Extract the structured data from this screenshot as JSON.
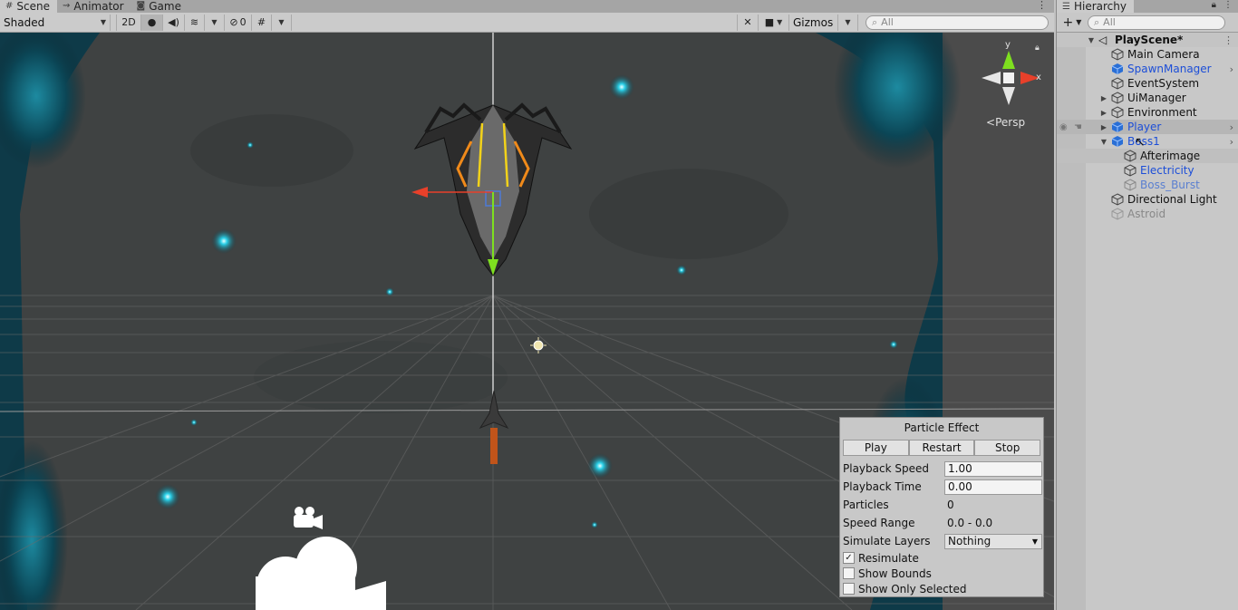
{
  "scene_tabs": [
    {
      "label": "Scene",
      "icon": "hash-icon"
    },
    {
      "label": "Animator",
      "icon": "animator-icon"
    },
    {
      "label": "Game",
      "icon": "gamepad-icon"
    }
  ],
  "toolbar": {
    "shading_mode": "Shaded",
    "mode_2d": "2D",
    "hidden_count": "0",
    "gizmos": "Gizmos",
    "search_placeholder": "All"
  },
  "viewport": {
    "projection": "Persp",
    "axis_y": "y",
    "axis_x": "x"
  },
  "particle_effect": {
    "title": "Particle Effect",
    "buttons": [
      "Play",
      "Restart",
      "Stop"
    ],
    "fields": {
      "playback_speed_label": "Playback Speed",
      "playback_speed": "1.00",
      "playback_time_label": "Playback Time",
      "playback_time": "0.00",
      "particles_label": "Particles",
      "particles": "0",
      "speed_range_label": "Speed Range",
      "speed_range": "0.0 - 0.0",
      "simulate_layers_label": "Simulate Layers",
      "simulate_layers": "Nothing"
    },
    "checks": [
      {
        "label": "Resimulate",
        "checked": true
      },
      {
        "label": "Show Bounds",
        "checked": false
      },
      {
        "label": "Show Only Selected",
        "checked": false
      }
    ]
  },
  "hierarchy": {
    "tab": "Hierarchy",
    "search_placeholder": "All",
    "scene": "PlayScene*",
    "items": [
      {
        "name": "Main Camera"
      },
      {
        "name": "SpawnManager"
      },
      {
        "name": "EventSystem"
      },
      {
        "name": "UiManager"
      },
      {
        "name": "Environment"
      },
      {
        "name": "Player"
      },
      {
        "name": "Boss1"
      },
      {
        "name": "Afterimage"
      },
      {
        "name": "Electricity"
      },
      {
        "name": "Boss_Burst"
      },
      {
        "name": "Directional Light"
      },
      {
        "name": "Astroid"
      }
    ]
  },
  "colors": {
    "selection_blue": "#1c4ed8",
    "axis_red": "#e8402a",
    "axis_green": "#7ee01f"
  }
}
